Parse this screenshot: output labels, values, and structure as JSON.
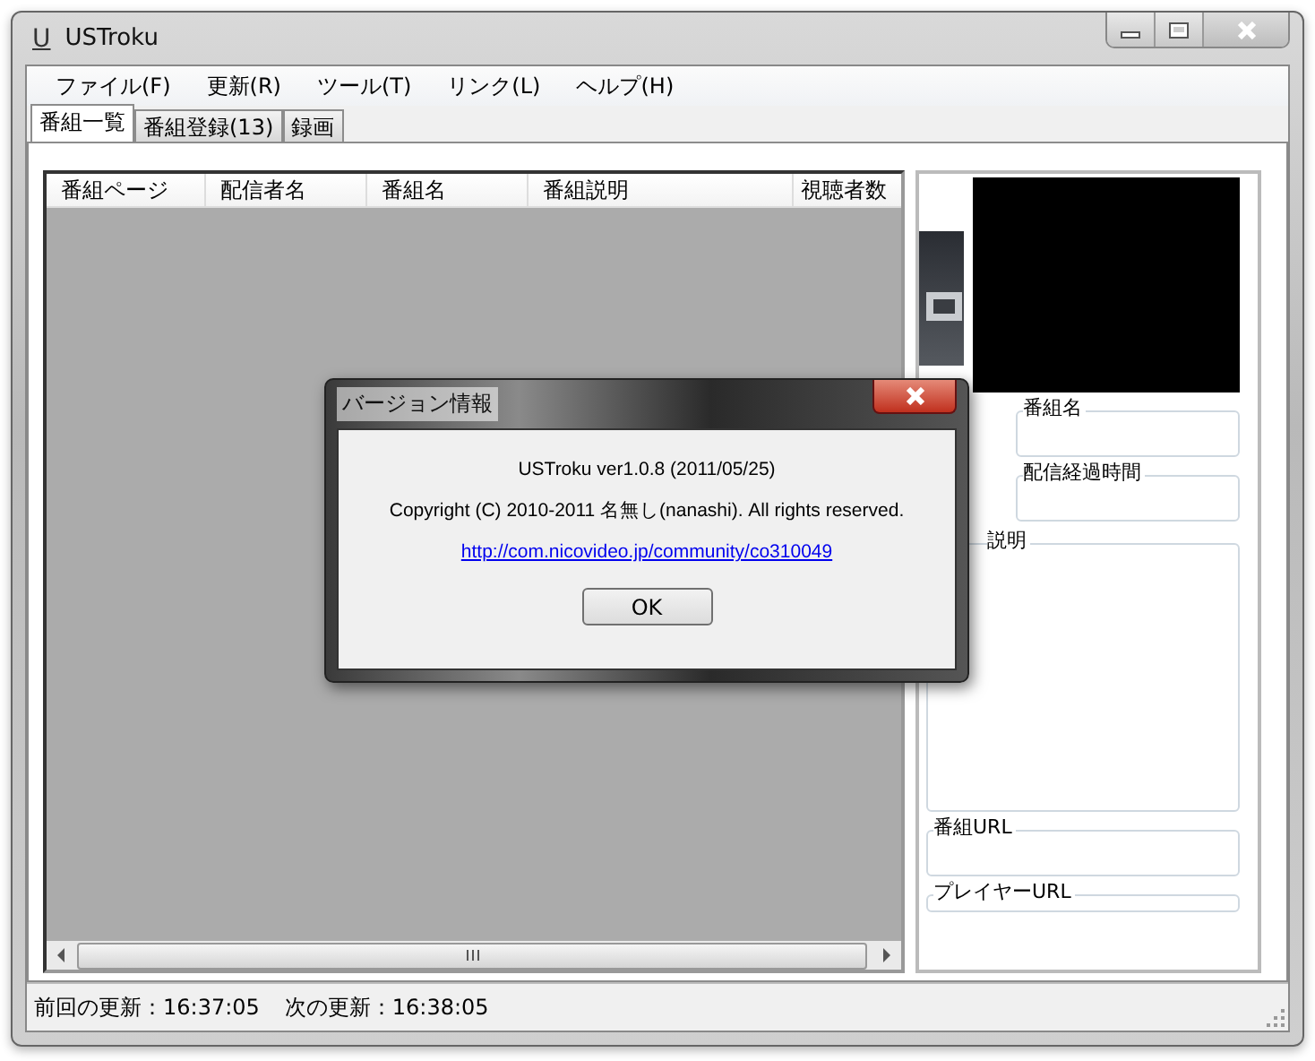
{
  "window": {
    "title": "USTroku",
    "icon": "U"
  },
  "menu": [
    "ファイル(F)",
    "更新(R)",
    "ツール(T)",
    "リンク(L)",
    "ヘルプ(H)"
  ],
  "tabs": [
    {
      "label": "番組一覧",
      "selected": true
    },
    {
      "label": "番組登録(13)",
      "selected": false
    },
    {
      "label": "録画",
      "selected": false
    }
  ],
  "table": {
    "columns": [
      "番組ページ",
      "配信者名",
      "番組名",
      "番組説明",
      "視聴者数"
    ]
  },
  "details": {
    "fields": [
      {
        "label": "番組名",
        "kind": "line"
      },
      {
        "label": "配信経過時間",
        "kind": "line"
      },
      {
        "label": "説明",
        "kind": "area"
      },
      {
        "label": "番組URL",
        "kind": "line"
      },
      {
        "label": "プレイヤーURL",
        "kind": "cut"
      }
    ]
  },
  "status_bar": [
    "前回の更新：16:37:05",
    "次の更新：16:38:05"
  ],
  "dialog": {
    "title": "バージョン情報",
    "lines": [
      "USTroku ver1.0.8 (2011/05/25)",
      "Copyright (C) 2010-2011 名無し(nanashi). All rights reserved."
    ],
    "link": "http://com.nicovideo.jp/community/co310049",
    "button": "OK"
  }
}
